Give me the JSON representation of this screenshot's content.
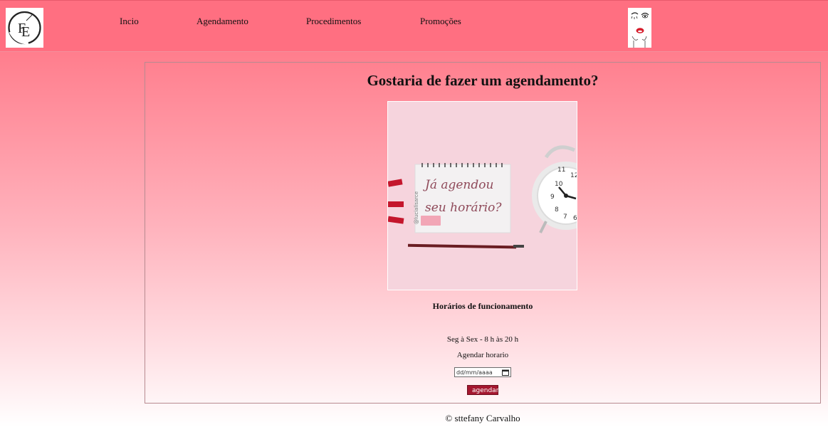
{
  "header": {
    "logo_left": {
      "letters": "FE",
      "icon": "fe-monogram-logo-icon"
    },
    "nav": [
      {
        "label": "Incio"
      },
      {
        "label": "Agendamento"
      },
      {
        "label": "Procedimentos"
      },
      {
        "label": "Promoções"
      }
    ],
    "logo_right": {
      "icon": "face-lips-logo-icon"
    }
  },
  "main": {
    "title": "Gostaria de fazer um agendamento?",
    "image": {
      "icon": "appointment-notebook-clock-image",
      "handwriting": [
        "Já agendou",
        "seu horário?"
      ],
      "watermark": "@lucialisarce"
    },
    "hours_title": "Horários de funcionamento",
    "hours_text": "Seg à Sex - 8 h às 20 h",
    "schedule_label": "Agendar horario",
    "date_input": {
      "placeholder": "dd/mm/aaaa"
    },
    "submit_label": "agendar"
  },
  "footer": {
    "text": "© sttefany Carvalho"
  },
  "colors": {
    "header_bg": "#ff6f81",
    "button_bg": "#a4172f",
    "photo_bg": "#f6d3dc"
  }
}
